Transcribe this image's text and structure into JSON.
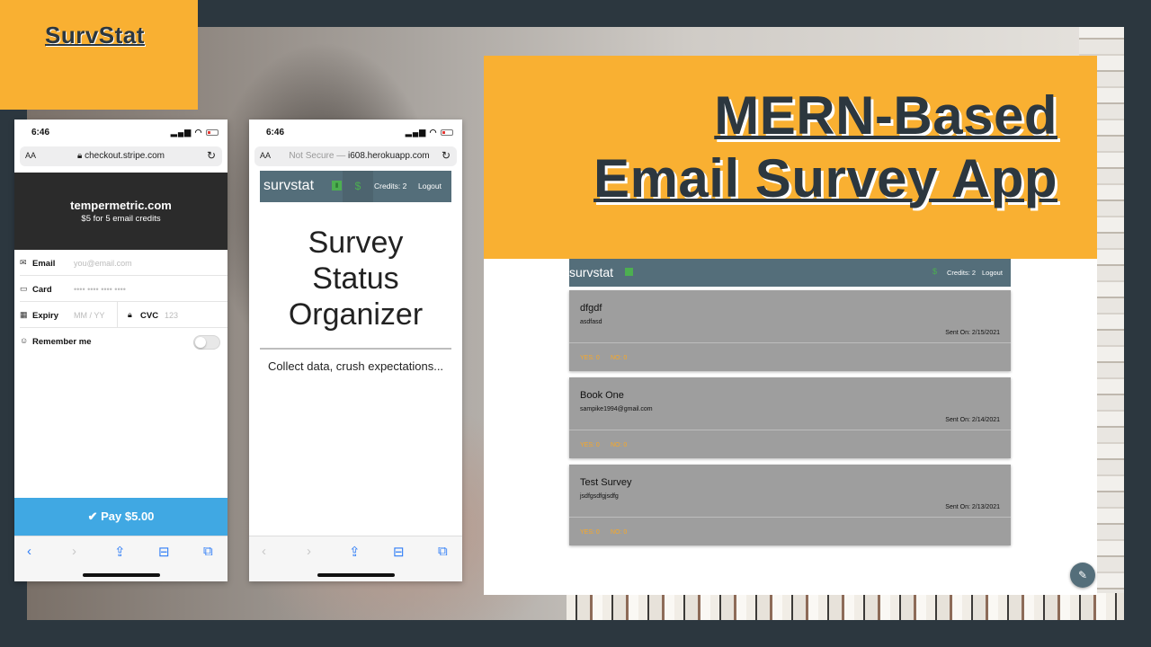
{
  "brand": {
    "label": "SurvStat"
  },
  "headline": {
    "line1": "MERN-Based",
    "line2": "Email Survey App"
  },
  "colors": {
    "accent": "#f9b032",
    "dark": "#2c373f",
    "nav": "#546e7a",
    "pay": "#40a8e3",
    "card": "#9e9e9e"
  },
  "checkout_phone": {
    "time": "6:46",
    "url_aa": "AA",
    "url": "checkout.stripe.com",
    "merchant": "tempermetric.com",
    "merchant_sub": "$5 for 5 email credits",
    "email_label": "Email",
    "email_placeholder": "you@email.com",
    "card_label": "Card",
    "card_placeholder": "•••• •••• •••• ••••",
    "expiry_label": "Expiry",
    "expiry_placeholder": "MM / YY",
    "cvc_label": "CVC",
    "cvc_placeholder": "123",
    "remember_label": "Remember me",
    "pay_label": "Pay $5.00"
  },
  "landing_phone": {
    "time": "6:46",
    "url_aa": "AA",
    "url_dim": "Not Secure — ",
    "url": "i608.herokuapp.com",
    "nav_logo": "survstat",
    "nav_credits": "Credits: 2",
    "nav_logout": "Logout",
    "title_line1": "Survey",
    "title_line2": "Status",
    "title_line3": "Organizer",
    "tagline": "Collect data, crush expectations..."
  },
  "dashboard": {
    "nav_logo": "survstat",
    "nav_credits": "Credits: 2",
    "nav_logout": "Logout",
    "surveys": [
      {
        "title": "dfgdf",
        "body": "asdfasd",
        "sent": "Sent On: 2/15/2021",
        "yes": "YES: 0",
        "no": "NO: 0"
      },
      {
        "title": "Book One",
        "body": "sampike1994@gmail.com",
        "sent": "Sent On: 2/14/2021",
        "yes": "YES: 0",
        "no": "NO: 0"
      },
      {
        "title": "Test Survey",
        "body": "jsdfgsdfgjsdfg",
        "sent": "Sent On: 2/13/2021",
        "yes": "YES: 0",
        "no": "NO: 0"
      }
    ]
  },
  "icons": [
    "lock-icon",
    "reload-icon",
    "mail-icon",
    "card-icon",
    "calendar-icon",
    "person-icon",
    "check-icon",
    "back-icon",
    "forward-icon",
    "share-icon",
    "bookmarks-icon",
    "tabs-icon",
    "chart-icon",
    "dollar-icon",
    "pencil-icon"
  ]
}
